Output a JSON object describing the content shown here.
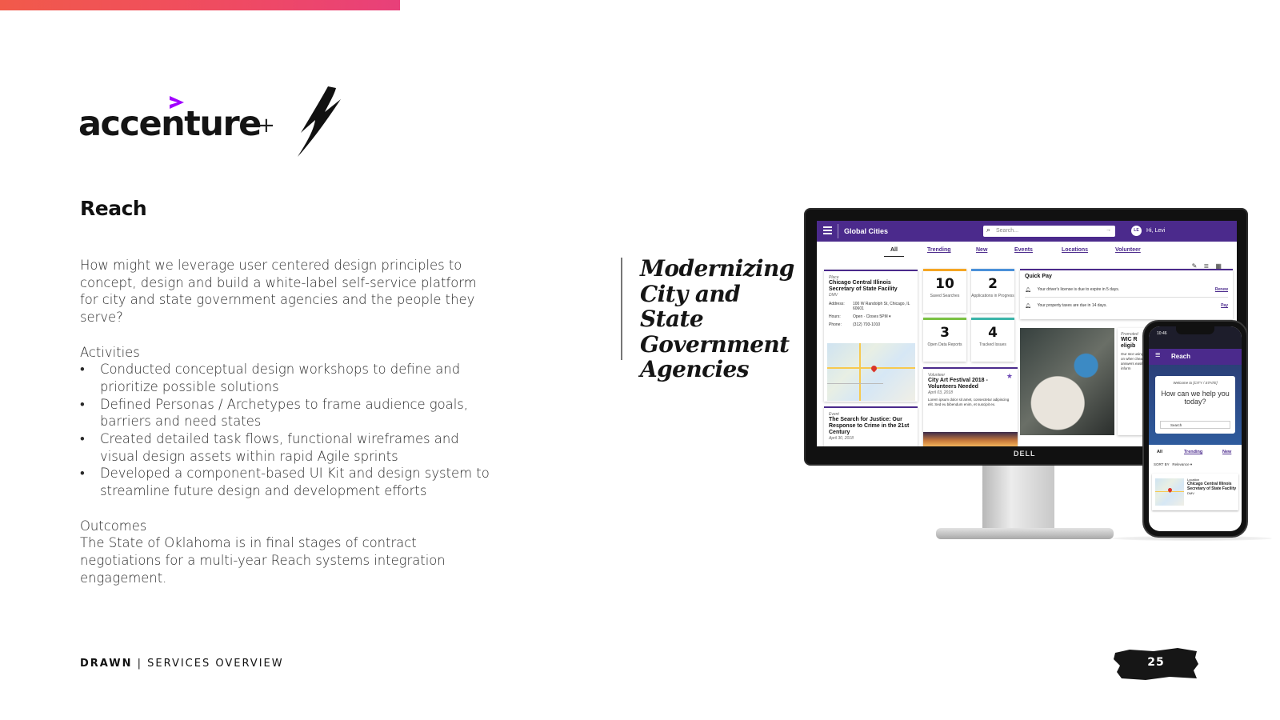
{
  "brand": {
    "partner_logo": "accenture",
    "plus": "+",
    "bolt_logo": "drawn-bolt"
  },
  "project": {
    "title": "Reach",
    "intro": "How might we leverage user centered design principles to concept, design and build a white-label self-service platform for city and state government agencies and the people they serve?",
    "activities_heading": "Activities",
    "activities": [
      "Conducted conceptual design workshops to define and prioritize possible solutions",
      "Defined Personas / Archetypes to frame audience  goals, barriers and need states",
      "Created detailed task flows, functional wireframes and visual design assets within rapid Agile sprints",
      "Developed a component-based UI Kit and design system to streamline future design and development efforts"
    ],
    "outcomes_heading": "Outcomes",
    "outcomes": "The State of Oklahoma is in final stages of contract negotiations for a multi-year Reach systems integration engagement."
  },
  "tagline": "Modernizing City and State Government Agencies",
  "mockup": {
    "app_name": "Global Cities",
    "search_placeholder": "Search...",
    "avatar": "LE",
    "greeting": "Hi, Levi",
    "tabs": [
      "All",
      "Trending",
      "New",
      "Events",
      "Locations",
      "Volunteer"
    ],
    "place_card": {
      "caption": "Place",
      "title": "Chicago Central Illinois Secretary of State Facility",
      "sub": "DMV",
      "address_label": "Address:",
      "address": "100 W Randolph St, Chicago, IL 60601",
      "hours_label": "Hours:",
      "hours": "Open · Closes 5PM ▾",
      "phone_label": "Phone:",
      "phone": "(312) 793-1010"
    },
    "stats": [
      {
        "num": "10",
        "label": "Saved Searches"
      },
      {
        "num": "2",
        "label": "Applications in Progress"
      },
      {
        "num": "3",
        "label": "Open Data Reports"
      },
      {
        "num": "4",
        "label": "Tracked Issues"
      }
    ],
    "quick_pay": {
      "title": "Quick Pay",
      "rows": [
        {
          "text": "Your driver's license is due to expire in 5 days.",
          "action": "Renew"
        },
        {
          "text": "Your property taxes are due in 14 days.",
          "action": "Pay"
        }
      ]
    },
    "volunteer_card": {
      "caption": "Volunteer",
      "title": "City Art Festival 2018 - Volunteers Needed",
      "date": "April 03, 2018",
      "body": "Lorem ipsum dolor sit amet, consectetur adipiscing elit. Sed eu bibendum enim, et suscipit ex."
    },
    "event_card": {
      "caption": "Event",
      "title": "The Search for Justice: Our Response to Crime in the 21st Century",
      "date": "April 30, 2018"
    },
    "promo_card": {
      "caption": "Promoted",
      "title": "WIC R eligib",
      "body": "Our stor using the on wher cheat sh answers easily p inform"
    },
    "monitor_brand": "DELL",
    "phone": {
      "time": "10:46",
      "app_name": "Reach",
      "welcome": "Welcome to [CITY / STATE]",
      "question": "How can we help you today?",
      "search": "Search",
      "tabs": [
        "All",
        "Trending",
        "New"
      ],
      "sort_label": "SORT BY",
      "sort_value": "Relevance ▾",
      "card_caption": "Location",
      "card_title": "Chicago Central Illinois Secretary of State Facility",
      "card_sub": "DMV"
    }
  },
  "footer": {
    "brand": "DRAWN",
    "separator": "|",
    "section": "SERVICES OVERVIEW",
    "page": "25"
  },
  "colors": {
    "accent_purple": "#4b2a8c",
    "accenture_purple": "#a100ff",
    "top_bar_start": "#f15a4a",
    "top_bar_end": "#e8407a"
  }
}
